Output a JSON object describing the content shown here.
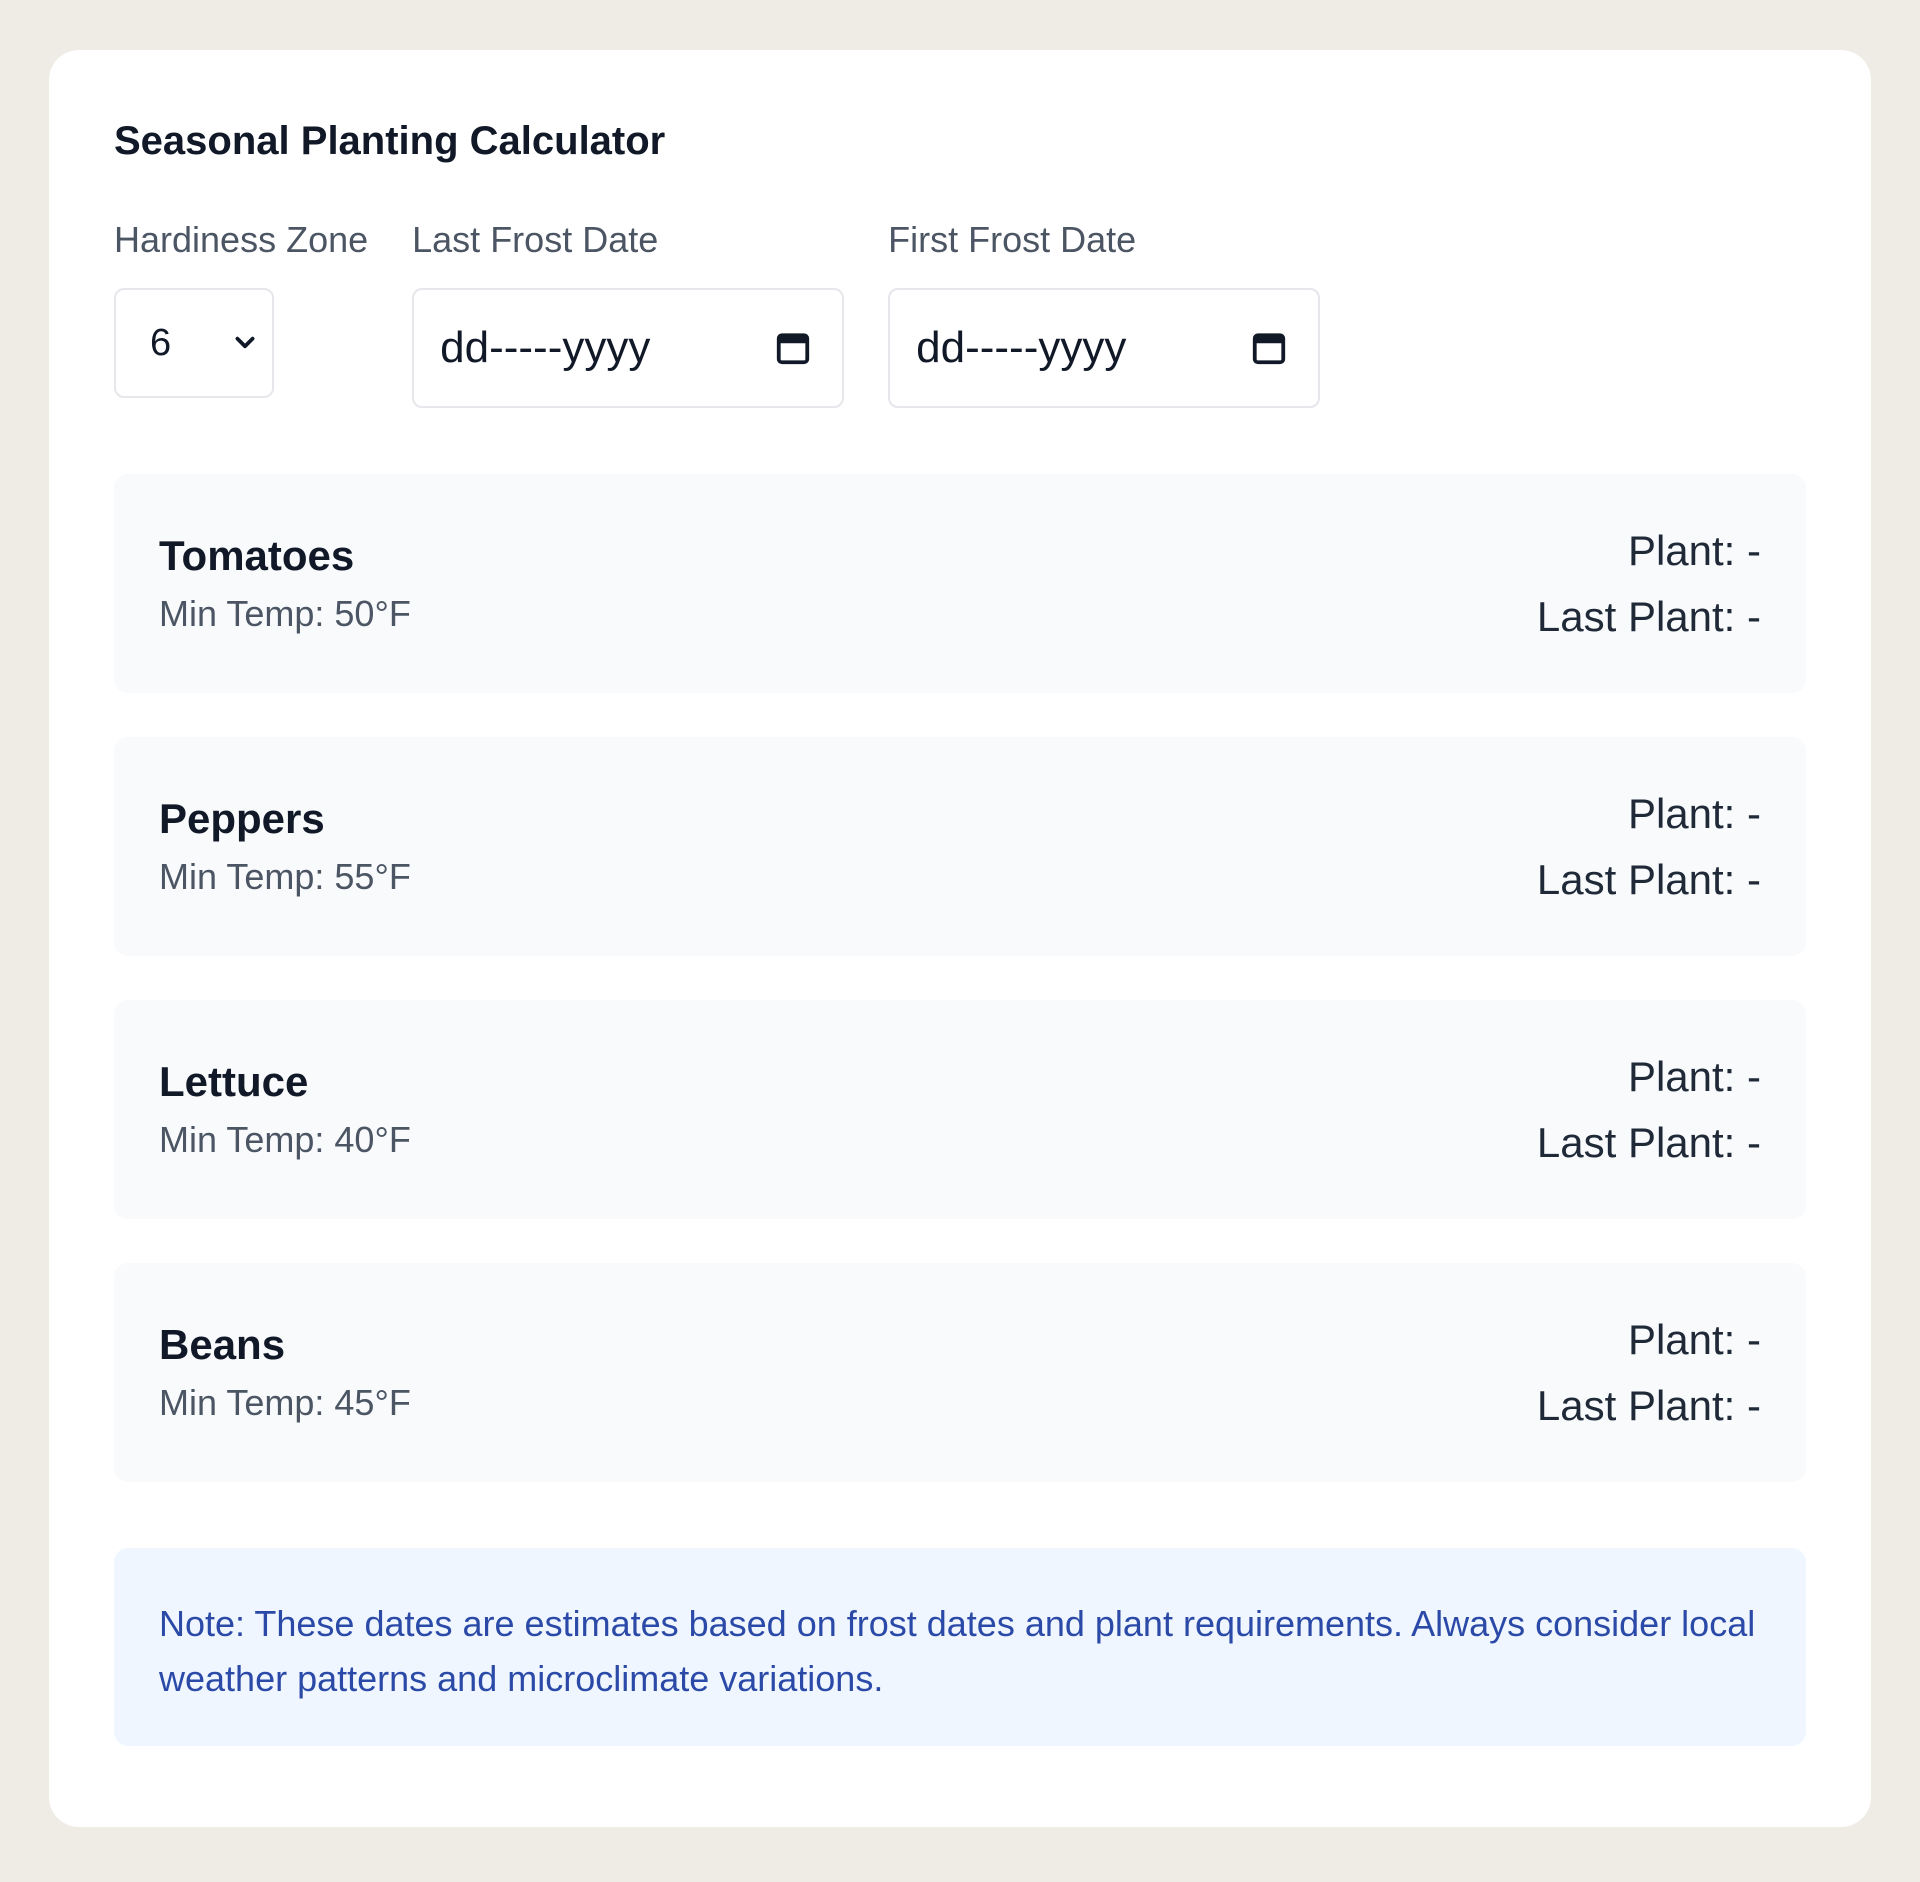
{
  "title": "Seasonal Planting Calculator",
  "controls": {
    "zone_label": "Hardiness Zone",
    "zone_value": "6",
    "last_frost_label": "Last Frost Date",
    "last_frost_placeholder": "dd-----yyyy",
    "first_frost_label": "First Frost Date",
    "first_frost_placeholder": "dd-----yyyy"
  },
  "crops": [
    {
      "name": "Tomatoes",
      "min_temp": "Min Temp: 50°F",
      "plant": "Plant: -",
      "last_plant": "Last Plant: -"
    },
    {
      "name": "Peppers",
      "min_temp": "Min Temp: 55°F",
      "plant": "Plant: -",
      "last_plant": "Last Plant: -"
    },
    {
      "name": "Lettuce",
      "min_temp": "Min Temp: 40°F",
      "plant": "Plant: -",
      "last_plant": "Last Plant: -"
    },
    {
      "name": "Beans",
      "min_temp": "Min Temp: 45°F",
      "plant": "Plant: -",
      "last_plant": "Last Plant: -"
    }
  ],
  "note": "Note: These dates are estimates based on frost dates and plant requirements. Always consider local weather patterns and microclimate variations.",
  "colors": {
    "background": "#efece6",
    "card": "#ffffff",
    "crop_bg": "#f8fafc",
    "note_bg": "#eff6ff",
    "note_text": "#2b4aa8"
  }
}
